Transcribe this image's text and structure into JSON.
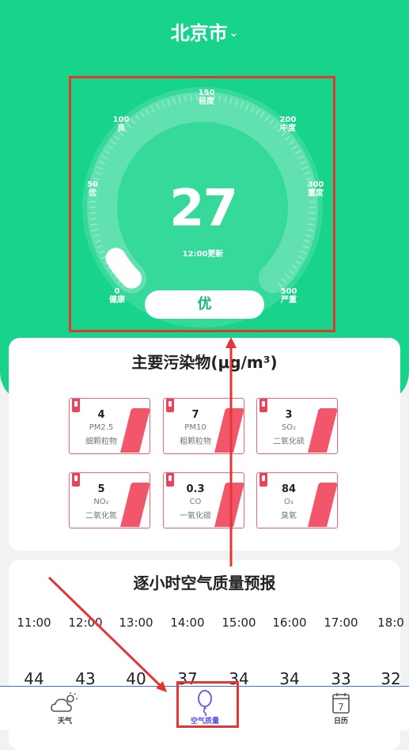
{
  "header": {
    "city": "北京市",
    "chevron_icon": "chevron-down-icon"
  },
  "gauge": {
    "aqi": "27",
    "updated": "12:00更新",
    "level": "优",
    "level_fraction": 0.054,
    "ticks": [
      {
        "value": "0",
        "label": "健康"
      },
      {
        "value": "50",
        "label": "优"
      },
      {
        "value": "100",
        "label": "良"
      },
      {
        "value": "150",
        "label": "轻度"
      },
      {
        "value": "200",
        "label": "中度"
      },
      {
        "value": "300",
        "label": "重度"
      },
      {
        "value": "500",
        "label": "严重"
      }
    ]
  },
  "pollutants": {
    "title": "主要污染物(μg/m³)",
    "items": [
      {
        "value": "4",
        "code": "PM2.5",
        "name": "细颗粒物"
      },
      {
        "value": "7",
        "code": "PM10",
        "name": "粗颗粒物"
      },
      {
        "value": "3",
        "code": "SO₂",
        "name": "二氧化硫"
      },
      {
        "value": "5",
        "code": "NO₂",
        "name": "二氧化氮"
      },
      {
        "value": "0.3",
        "code": "CO",
        "name": "一氧化碳"
      },
      {
        "value": "84",
        "code": "O₃",
        "name": "臭氧"
      }
    ]
  },
  "forecast": {
    "title": "逐小时空气质量预报",
    "hours": [
      "11:00",
      "12:00",
      "13:00",
      "14:00",
      "15:00",
      "16:00",
      "17:00",
      "18:0"
    ],
    "values": [
      "44",
      "43",
      "40",
      "37",
      "34",
      "34",
      "33",
      "32"
    ]
  },
  "tabs": [
    {
      "label": "天气",
      "icon": "cloud-sun-icon"
    },
    {
      "label": "空气质量",
      "icon": "balloon-icon",
      "active": true
    },
    {
      "label": "日历",
      "icon": "calendar-icon",
      "day": "7"
    }
  ],
  "colors": {
    "primary": "#17d48a",
    "pollutant_accent": "#f2566b",
    "active_tab": "#5b56e0",
    "annotation": "#e53535"
  }
}
